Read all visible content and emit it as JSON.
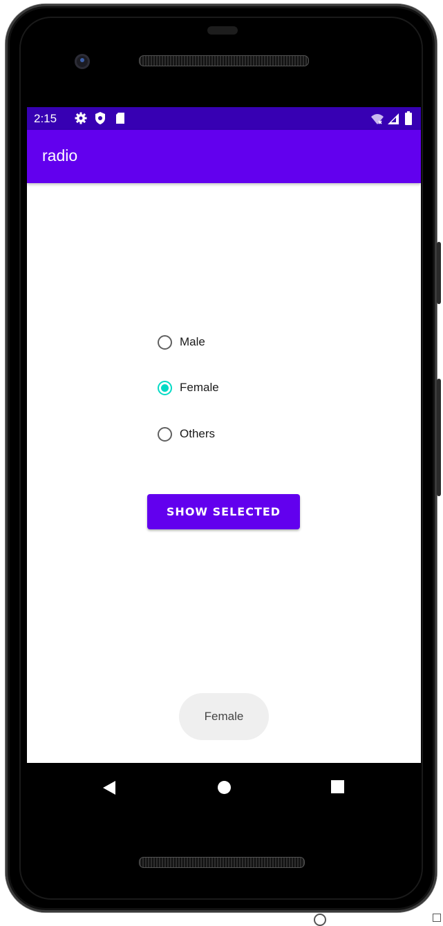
{
  "status_bar": {
    "time": "2:15",
    "left_icons": [
      "settings-icon",
      "shield-icon",
      "sd-card-icon"
    ],
    "right_icons": [
      "wifi-icon",
      "signal-icon",
      "battery-icon"
    ]
  },
  "app_bar": {
    "title": "radio"
  },
  "radio_group": {
    "options": [
      {
        "label": "Male",
        "checked": false
      },
      {
        "label": "Female",
        "checked": true
      },
      {
        "label": "Others",
        "checked": false
      }
    ]
  },
  "button": {
    "label": "SHOW SELECTED"
  },
  "toast": {
    "text": "Female"
  },
  "colors": {
    "status_bar": "#3700b3",
    "app_bar": "#6200ee",
    "accent": "#03dac5",
    "button": "#6200ee"
  },
  "nav_bar": {
    "icons": [
      "back-icon",
      "home-icon",
      "recents-icon"
    ]
  }
}
